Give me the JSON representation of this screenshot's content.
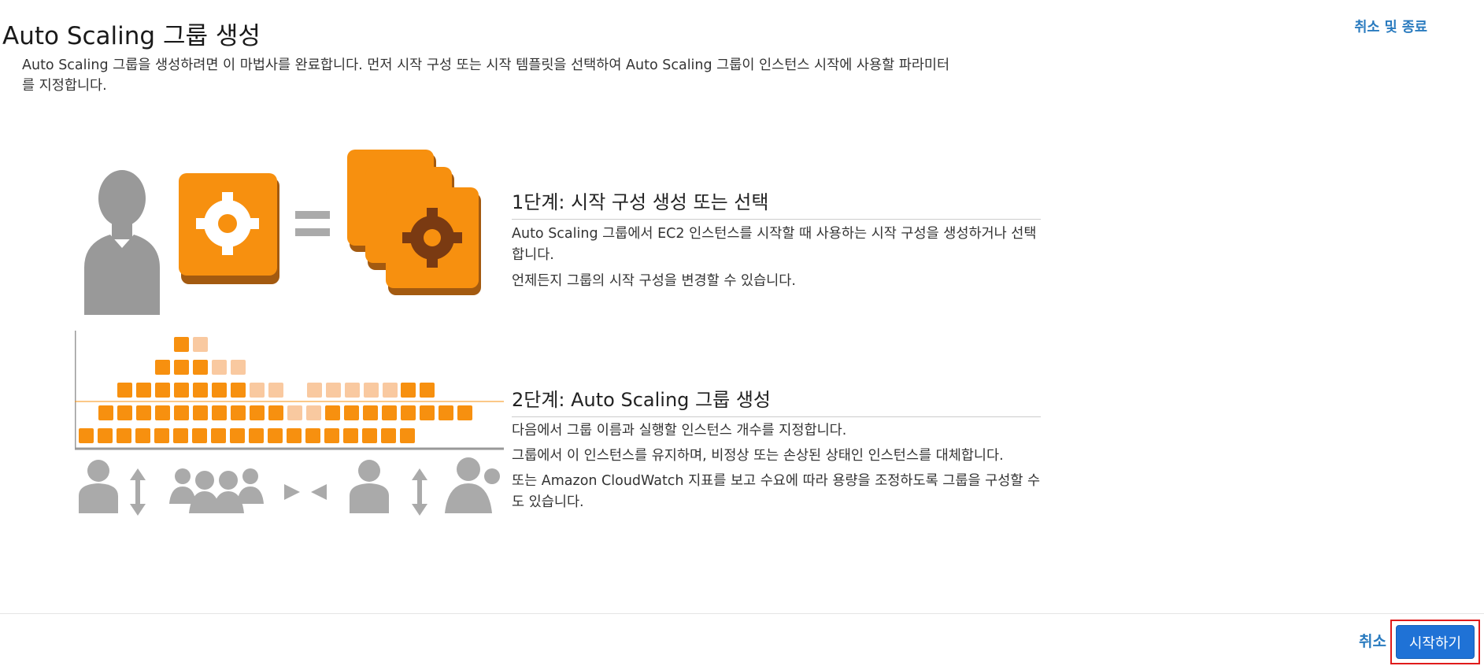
{
  "header": {
    "title": "Auto Scaling 그룹 생성",
    "cancel_exit": "취소 및 종료",
    "intro": "Auto Scaling 그룹을 생성하려면 이 마법사를 완료합니다. 먼저 시작 구성 또는 시작 템플릿을 선택하여 Auto Scaling 그룹이 인스턴스 시작에 사용할 파라미터를 지정합니다."
  },
  "step1": {
    "title": "1단계: 시작 구성 생성 또는 선택",
    "p1": "Auto Scaling 그룹에서 EC2 인스턴스를 시작할 때 사용하는 시작 구성을 생성하거나 선택합니다.",
    "p2": "언제든지 그룹의 시작 구성을 변경할 수 있습니다."
  },
  "step2": {
    "title": "2단계: Auto Scaling 그룹 생성",
    "p1": "다음에서 그룹 이름과 실행할 인스턴스 개수를 지정합니다.",
    "p2": "그룹에서 이 인스턴스를 유지하며, 비정상 또는 손상된 상태인 인스턴스를 대체합니다.",
    "p3": "또는 Amazon CloudWatch 지표를 보고 수요에 따라 용량을 조정하도록 그룹을 구성할 수도 있습니다."
  },
  "footer": {
    "cancel": "취소",
    "start": "시작하기"
  },
  "colors": {
    "accent": "#1f72d6",
    "link": "#2a7bbf",
    "orange": "#f7900f",
    "orange_light": "#f9c9a0",
    "gray": "#9a9a9a",
    "highlight": "#e01b1b"
  },
  "icons": [
    "user-icon",
    "gear-icon",
    "equals-icon",
    "stacked-gear-cards-icon",
    "capacity-bars",
    "up-down-arrow-icon",
    "group-icon",
    "merge-arrows-icon"
  ]
}
